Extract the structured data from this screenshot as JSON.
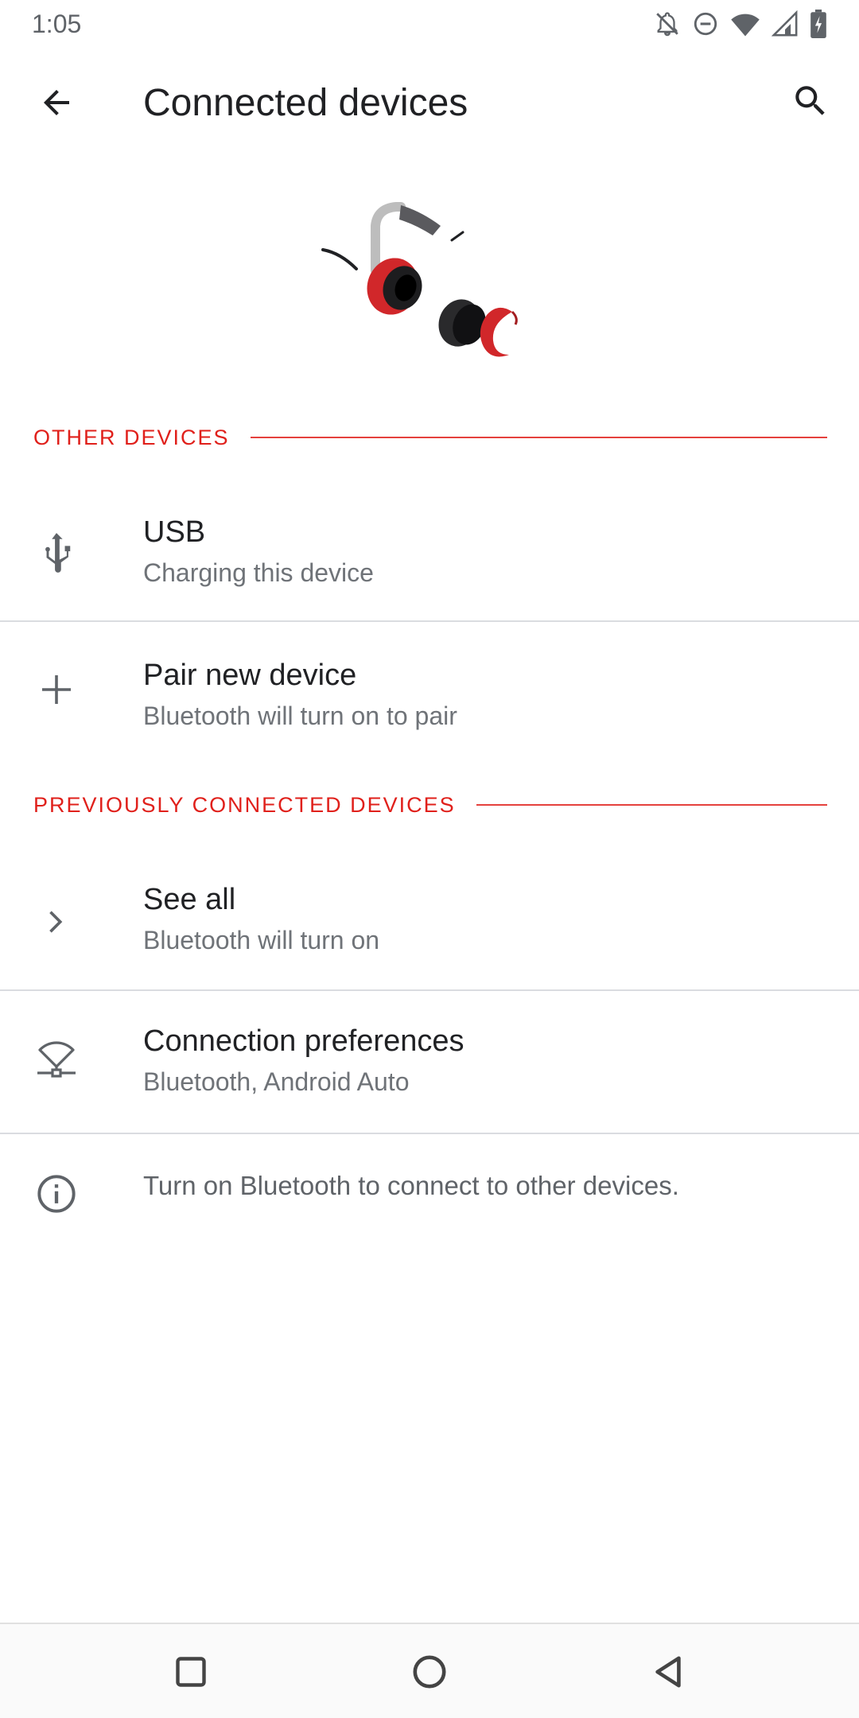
{
  "status_bar": {
    "time": "1:05",
    "icons": [
      "notifications-off-icon",
      "do-not-disturb-icon",
      "wifi-icon",
      "cell-signal-icon",
      "battery-charging-icon"
    ]
  },
  "app_bar": {
    "title": "Connected devices",
    "back_icon": "arrow-back-icon",
    "search_icon": "search-icon"
  },
  "sections": {
    "other_devices": "OTHER DEVICES",
    "previously_connected": "PREVIOUSLY CONNECTED DEVICES"
  },
  "items": {
    "usb": {
      "title": "USB",
      "subtitle": "Charging this device",
      "icon": "usb-icon"
    },
    "pair": {
      "title": "Pair new device",
      "subtitle": "Bluetooth will turn on to pair",
      "icon": "plus-icon"
    },
    "see_all": {
      "title": "See all",
      "subtitle": "Bluetooth will turn on",
      "icon": "chevron-right-icon"
    },
    "connection_prefs": {
      "title": "Connection preferences",
      "subtitle": "Bluetooth, Android Auto",
      "icon": "devices-other-icon"
    }
  },
  "info": {
    "text": "Turn on Bluetooth to connect to other devices.",
    "icon": "info-icon"
  },
  "colors": {
    "accent": "#e0201b",
    "text_primary": "#202124",
    "text_secondary": "#6f7378"
  },
  "nav_bar": {
    "recents_icon": "square-recents-icon",
    "home_icon": "circle-home-icon",
    "back_icon": "triangle-back-icon"
  }
}
